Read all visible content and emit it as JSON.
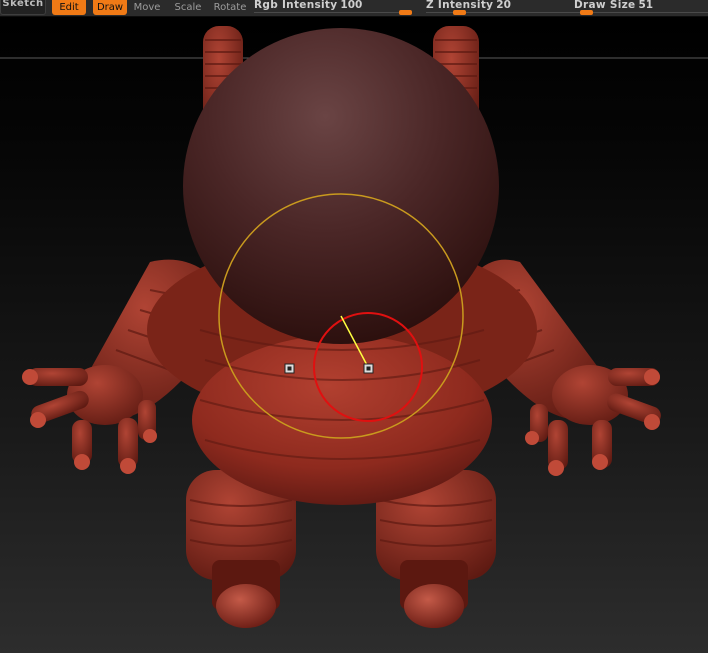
{
  "toolbar": {
    "sketch_label": "Sketch",
    "edit_label": "Edit",
    "draw_label": "Draw",
    "move_label": "Move",
    "scale_label": "Scale",
    "rotate_label": "Rotate",
    "rgb_intensity": {
      "label": "Rgb Intensity",
      "value": "100",
      "level": 1.0
    },
    "z_intensity": {
      "label": "Z Intensity",
      "value": "20",
      "level": 0.2
    },
    "draw_size": {
      "label": "Draw Size",
      "value": "51",
      "level": 0.05
    }
  },
  "colors": {
    "accent": "#f07a16",
    "model": "#8a2a1f",
    "brush_outer": "#d4a020",
    "brush_inner": "#e01010",
    "stroke_line": "#ffff40"
  },
  "icons": [
    "gizmo-handle-icon"
  ]
}
